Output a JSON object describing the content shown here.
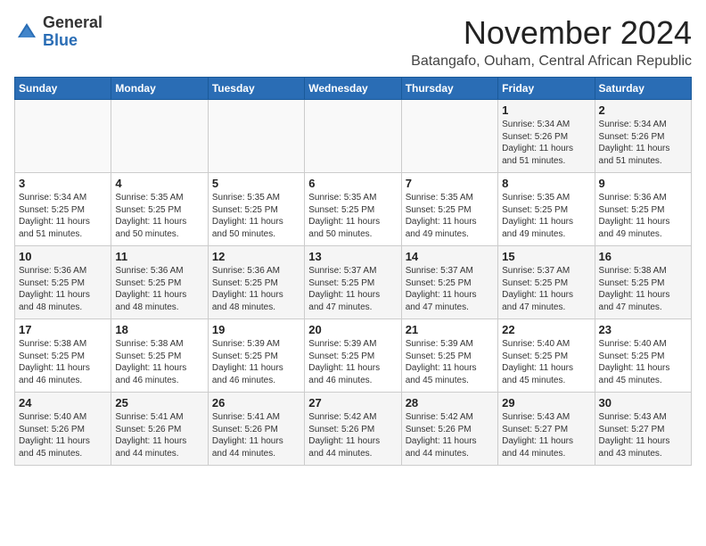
{
  "header": {
    "logo_general": "General",
    "logo_blue": "Blue",
    "month_title": "November 2024",
    "location": "Batangafo, Ouham, Central African Republic"
  },
  "weekdays": [
    "Sunday",
    "Monday",
    "Tuesday",
    "Wednesday",
    "Thursday",
    "Friday",
    "Saturday"
  ],
  "weeks": [
    [
      {
        "day": "",
        "info": ""
      },
      {
        "day": "",
        "info": ""
      },
      {
        "day": "",
        "info": ""
      },
      {
        "day": "",
        "info": ""
      },
      {
        "day": "",
        "info": ""
      },
      {
        "day": "1",
        "info": "Sunrise: 5:34 AM\nSunset: 5:26 PM\nDaylight: 11 hours\nand 51 minutes."
      },
      {
        "day": "2",
        "info": "Sunrise: 5:34 AM\nSunset: 5:26 PM\nDaylight: 11 hours\nand 51 minutes."
      }
    ],
    [
      {
        "day": "3",
        "info": "Sunrise: 5:34 AM\nSunset: 5:25 PM\nDaylight: 11 hours\nand 51 minutes."
      },
      {
        "day": "4",
        "info": "Sunrise: 5:35 AM\nSunset: 5:25 PM\nDaylight: 11 hours\nand 50 minutes."
      },
      {
        "day": "5",
        "info": "Sunrise: 5:35 AM\nSunset: 5:25 PM\nDaylight: 11 hours\nand 50 minutes."
      },
      {
        "day": "6",
        "info": "Sunrise: 5:35 AM\nSunset: 5:25 PM\nDaylight: 11 hours\nand 50 minutes."
      },
      {
        "day": "7",
        "info": "Sunrise: 5:35 AM\nSunset: 5:25 PM\nDaylight: 11 hours\nand 49 minutes."
      },
      {
        "day": "8",
        "info": "Sunrise: 5:35 AM\nSunset: 5:25 PM\nDaylight: 11 hours\nand 49 minutes."
      },
      {
        "day": "9",
        "info": "Sunrise: 5:36 AM\nSunset: 5:25 PM\nDaylight: 11 hours\nand 49 minutes."
      }
    ],
    [
      {
        "day": "10",
        "info": "Sunrise: 5:36 AM\nSunset: 5:25 PM\nDaylight: 11 hours\nand 48 minutes."
      },
      {
        "day": "11",
        "info": "Sunrise: 5:36 AM\nSunset: 5:25 PM\nDaylight: 11 hours\nand 48 minutes."
      },
      {
        "day": "12",
        "info": "Sunrise: 5:36 AM\nSunset: 5:25 PM\nDaylight: 11 hours\nand 48 minutes."
      },
      {
        "day": "13",
        "info": "Sunrise: 5:37 AM\nSunset: 5:25 PM\nDaylight: 11 hours\nand 47 minutes."
      },
      {
        "day": "14",
        "info": "Sunrise: 5:37 AM\nSunset: 5:25 PM\nDaylight: 11 hours\nand 47 minutes."
      },
      {
        "day": "15",
        "info": "Sunrise: 5:37 AM\nSunset: 5:25 PM\nDaylight: 11 hours\nand 47 minutes."
      },
      {
        "day": "16",
        "info": "Sunrise: 5:38 AM\nSunset: 5:25 PM\nDaylight: 11 hours\nand 47 minutes."
      }
    ],
    [
      {
        "day": "17",
        "info": "Sunrise: 5:38 AM\nSunset: 5:25 PM\nDaylight: 11 hours\nand 46 minutes."
      },
      {
        "day": "18",
        "info": "Sunrise: 5:38 AM\nSunset: 5:25 PM\nDaylight: 11 hours\nand 46 minutes."
      },
      {
        "day": "19",
        "info": "Sunrise: 5:39 AM\nSunset: 5:25 PM\nDaylight: 11 hours\nand 46 minutes."
      },
      {
        "day": "20",
        "info": "Sunrise: 5:39 AM\nSunset: 5:25 PM\nDaylight: 11 hours\nand 46 minutes."
      },
      {
        "day": "21",
        "info": "Sunrise: 5:39 AM\nSunset: 5:25 PM\nDaylight: 11 hours\nand 45 minutes."
      },
      {
        "day": "22",
        "info": "Sunrise: 5:40 AM\nSunset: 5:25 PM\nDaylight: 11 hours\nand 45 minutes."
      },
      {
        "day": "23",
        "info": "Sunrise: 5:40 AM\nSunset: 5:25 PM\nDaylight: 11 hours\nand 45 minutes."
      }
    ],
    [
      {
        "day": "24",
        "info": "Sunrise: 5:40 AM\nSunset: 5:26 PM\nDaylight: 11 hours\nand 45 minutes."
      },
      {
        "day": "25",
        "info": "Sunrise: 5:41 AM\nSunset: 5:26 PM\nDaylight: 11 hours\nand 44 minutes."
      },
      {
        "day": "26",
        "info": "Sunrise: 5:41 AM\nSunset: 5:26 PM\nDaylight: 11 hours\nand 44 minutes."
      },
      {
        "day": "27",
        "info": "Sunrise: 5:42 AM\nSunset: 5:26 PM\nDaylight: 11 hours\nand 44 minutes."
      },
      {
        "day": "28",
        "info": "Sunrise: 5:42 AM\nSunset: 5:26 PM\nDaylight: 11 hours\nand 44 minutes."
      },
      {
        "day": "29",
        "info": "Sunrise: 5:43 AM\nSunset: 5:27 PM\nDaylight: 11 hours\nand 44 minutes."
      },
      {
        "day": "30",
        "info": "Sunrise: 5:43 AM\nSunset: 5:27 PM\nDaylight: 11 hours\nand 43 minutes."
      }
    ]
  ]
}
